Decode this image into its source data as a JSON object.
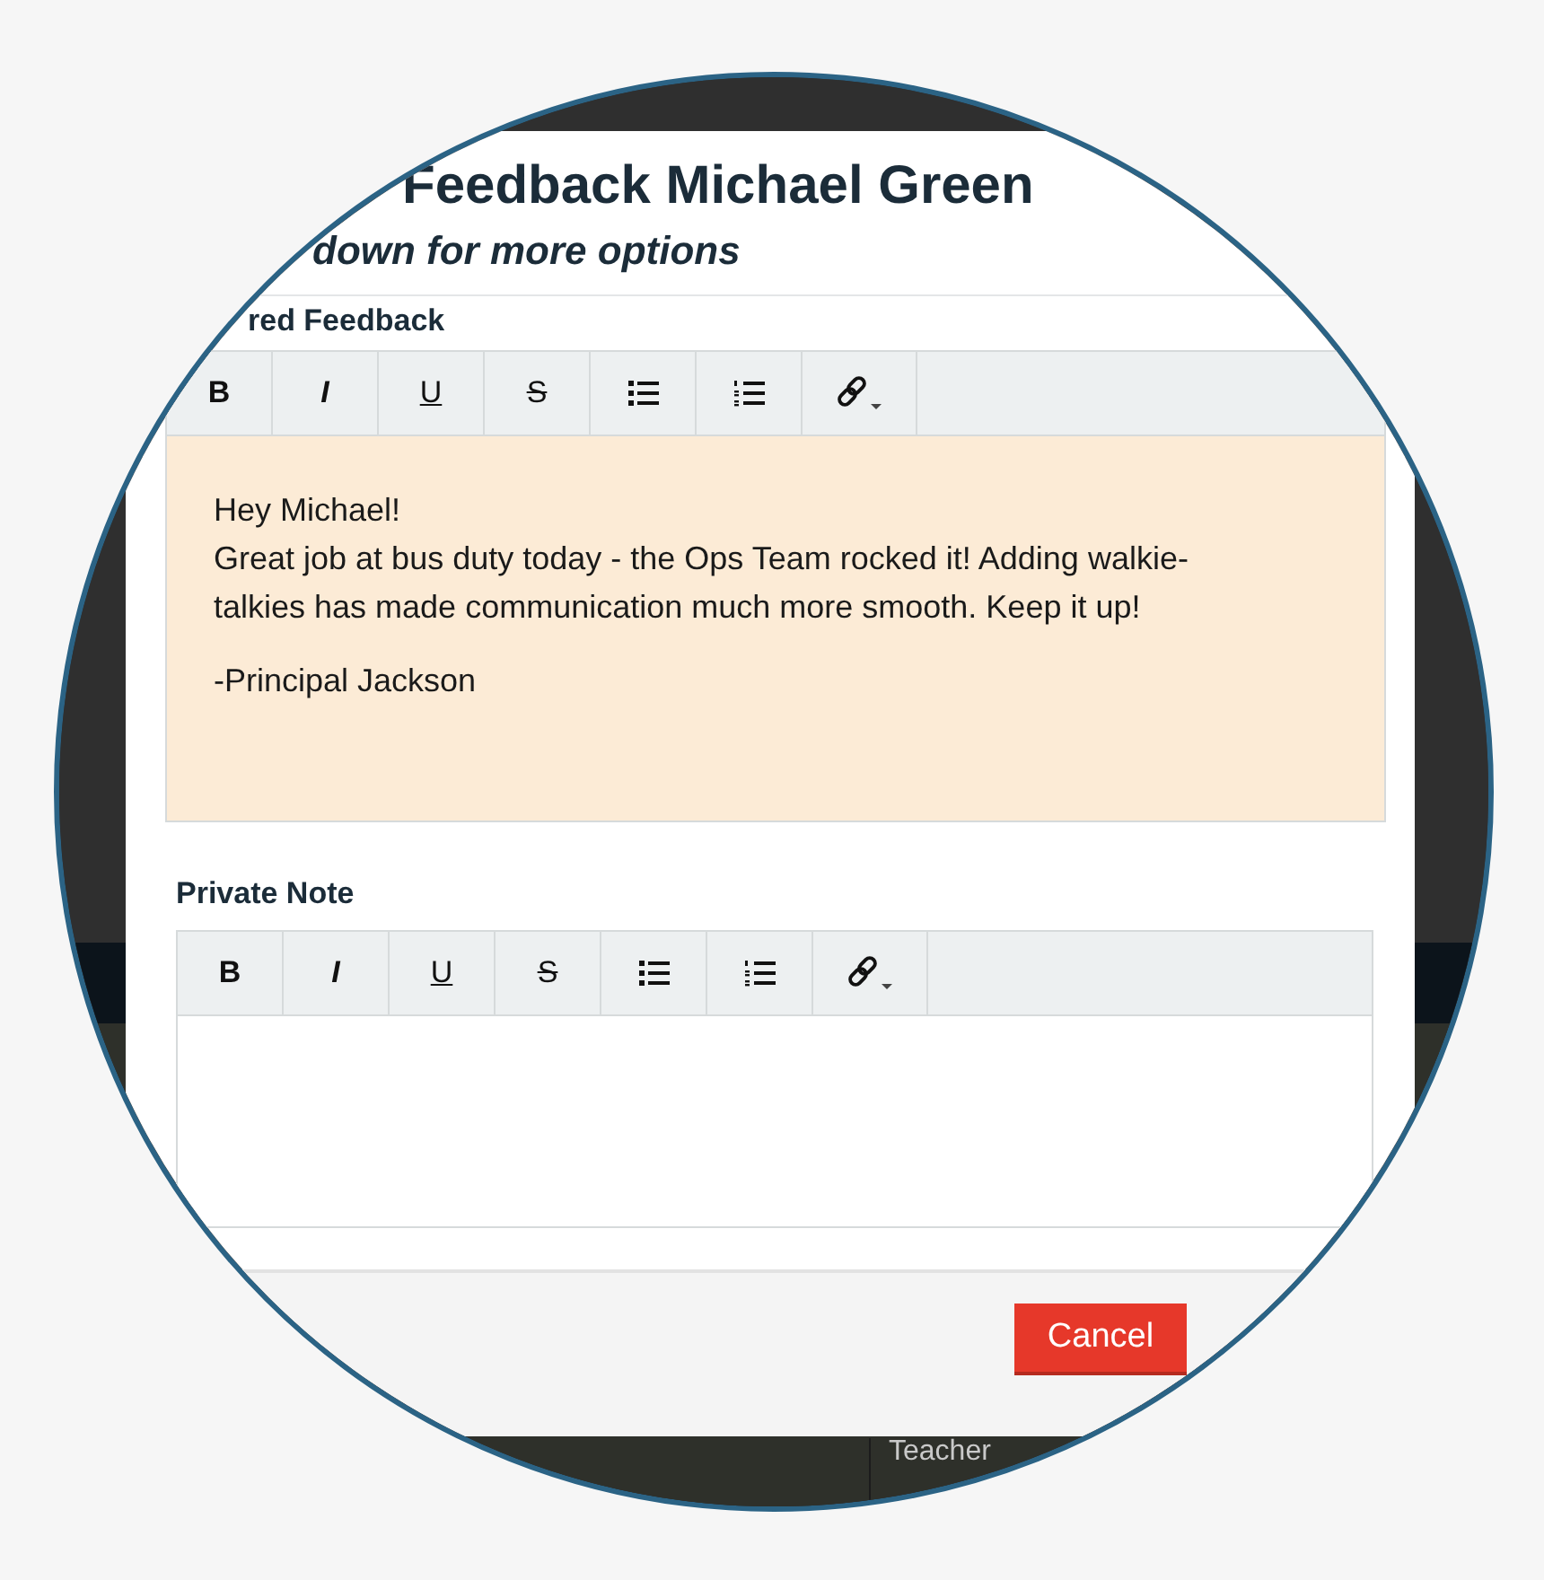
{
  "dialog": {
    "title": "Feedback Michael Green",
    "subtitle": "down for more options",
    "editors": [
      {
        "label": "red Feedback",
        "focused": true,
        "toolbar": [
          {
            "kind": "bold",
            "label": "B"
          },
          {
            "kind": "italic",
            "label": "I"
          },
          {
            "kind": "underline",
            "label": "U"
          },
          {
            "kind": "strike",
            "label": "S"
          },
          {
            "kind": "bullets"
          },
          {
            "kind": "numbers"
          },
          {
            "kind": "link"
          }
        ],
        "blocks": [
          {
            "lines": [
              "Hey Michael!",
              "Great job at bus duty today - the Ops Team rocked it! Adding walkie-talkies has made communication much more smooth. Keep it up!"
            ]
          },
          {
            "lines": [
              "-Principal Jackson"
            ]
          }
        ]
      },
      {
        "label": "Private Note",
        "focused": false,
        "toolbar": [
          {
            "kind": "bold",
            "label": "B"
          },
          {
            "kind": "italic",
            "label": "I"
          },
          {
            "kind": "underline",
            "label": "U"
          },
          {
            "kind": "strike",
            "label": "S"
          },
          {
            "kind": "bullets"
          },
          {
            "kind": "numbers"
          },
          {
            "kind": "link"
          }
        ]
      }
    ],
    "buttons": [
      {
        "kind": "cancel",
        "label": "Cancel"
      }
    ]
  },
  "background": {
    "cell_text": "Teacher"
  }
}
